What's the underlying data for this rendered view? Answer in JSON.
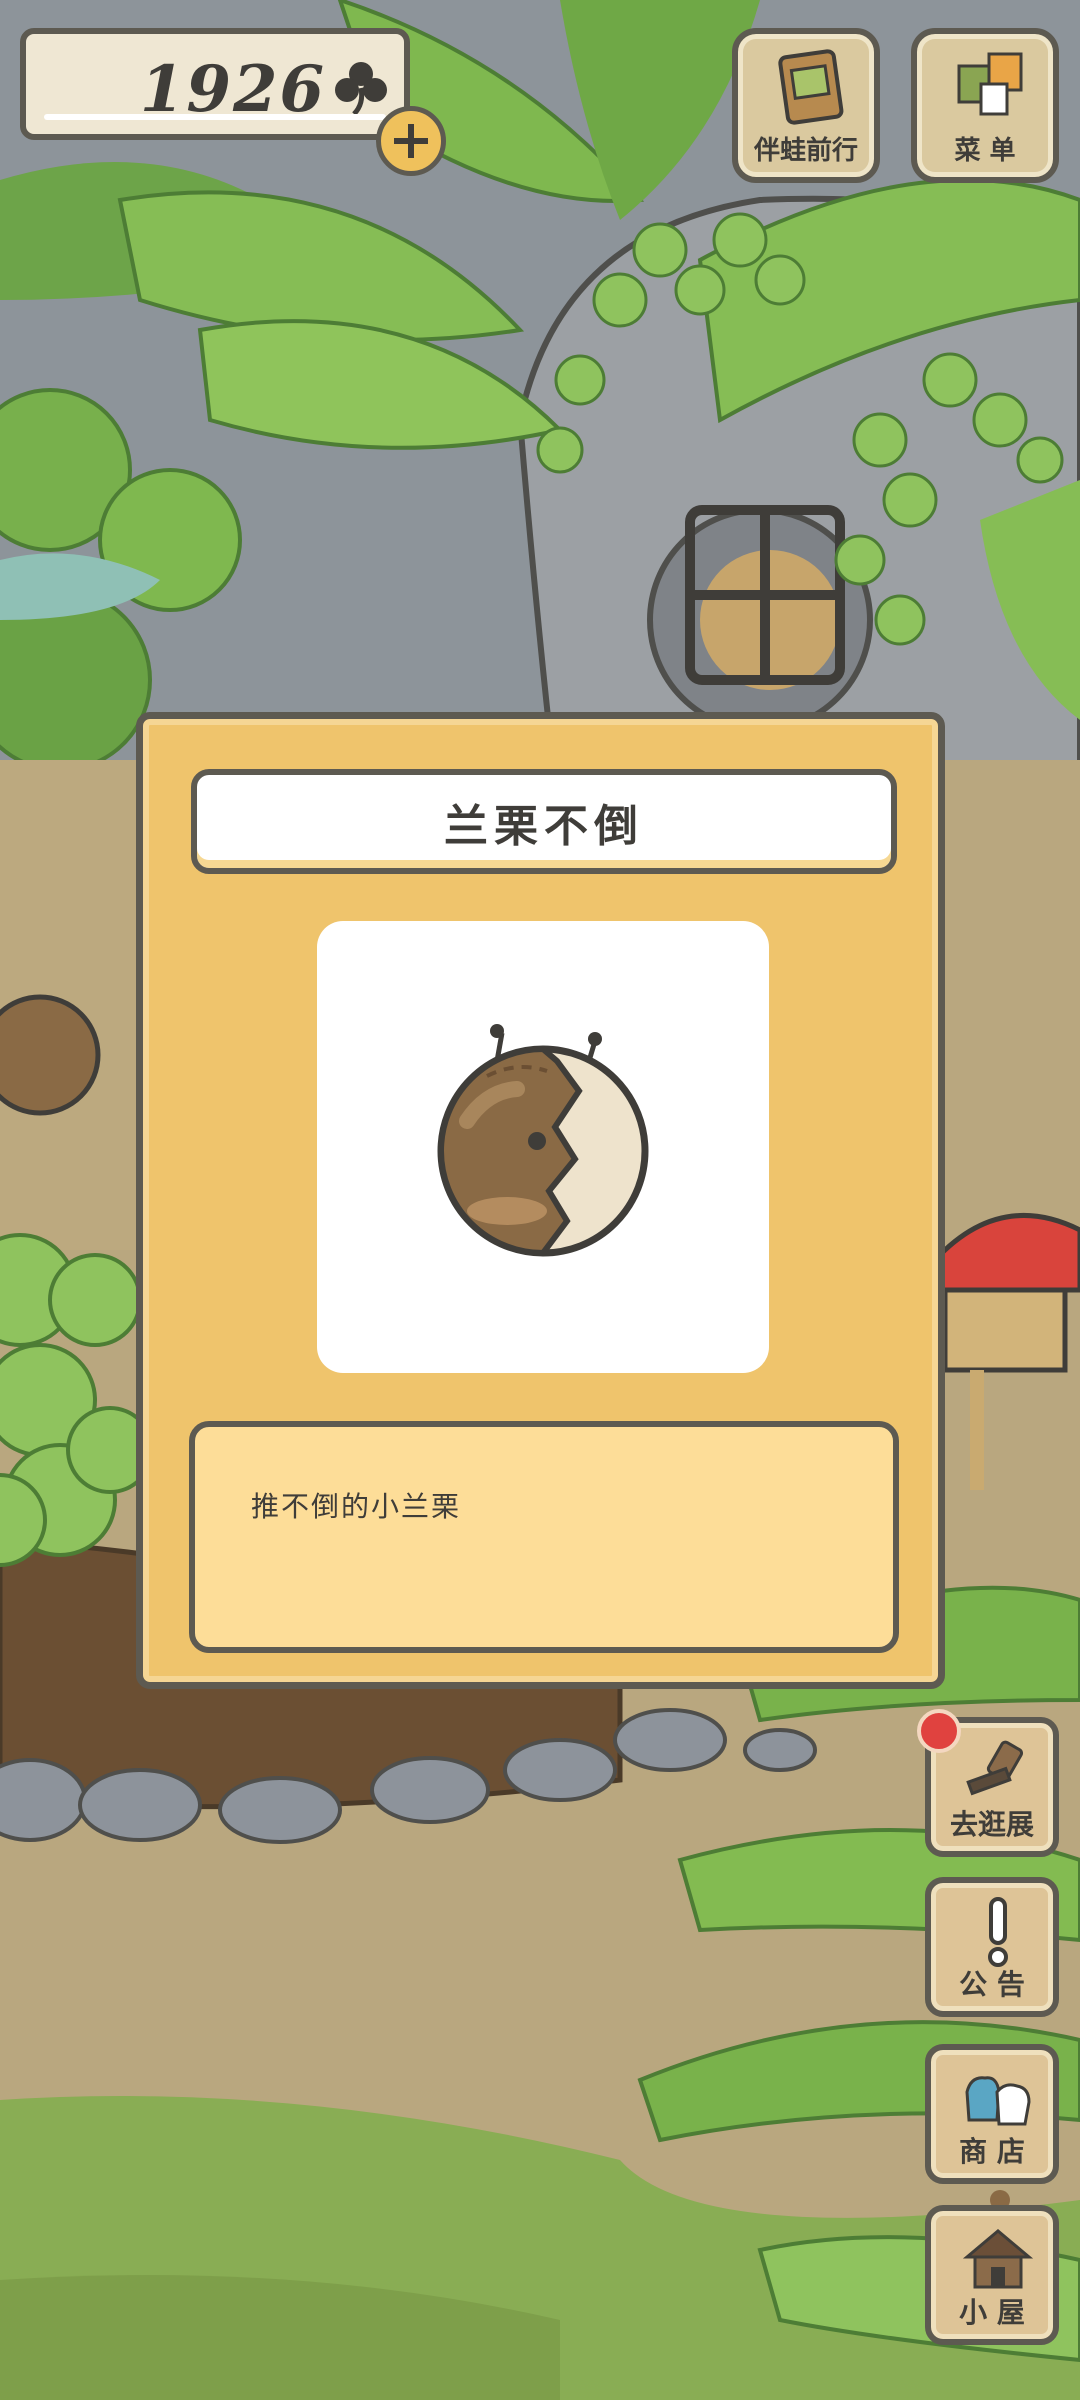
{
  "hud": {
    "clover_count": "1926",
    "travel_button_label": "伴蛙前行",
    "menu_button_label": "菜 单"
  },
  "side_buttons": [
    {
      "label": "去逛展",
      "has_notification": true
    },
    {
      "label": "公 告"
    },
    {
      "label": "商 店"
    },
    {
      "label": "小 屋"
    }
  ],
  "item_card": {
    "title": "兰栗不倒",
    "description": "推不倒的小兰栗"
  },
  "colors": {
    "card_bg": "#efc46c",
    "desc_bg": "#fddd98",
    "outline": "#5d5a51",
    "notification": "#e0423f"
  },
  "icons": {
    "clover": "clover-icon",
    "add": "plus-icon",
    "travel": "map-book-icon",
    "menu": "cards-icon",
    "exhibit": "hammer-icon",
    "notice": "exclamation-icon",
    "shop": "bags-icon",
    "house": "house-icon"
  }
}
